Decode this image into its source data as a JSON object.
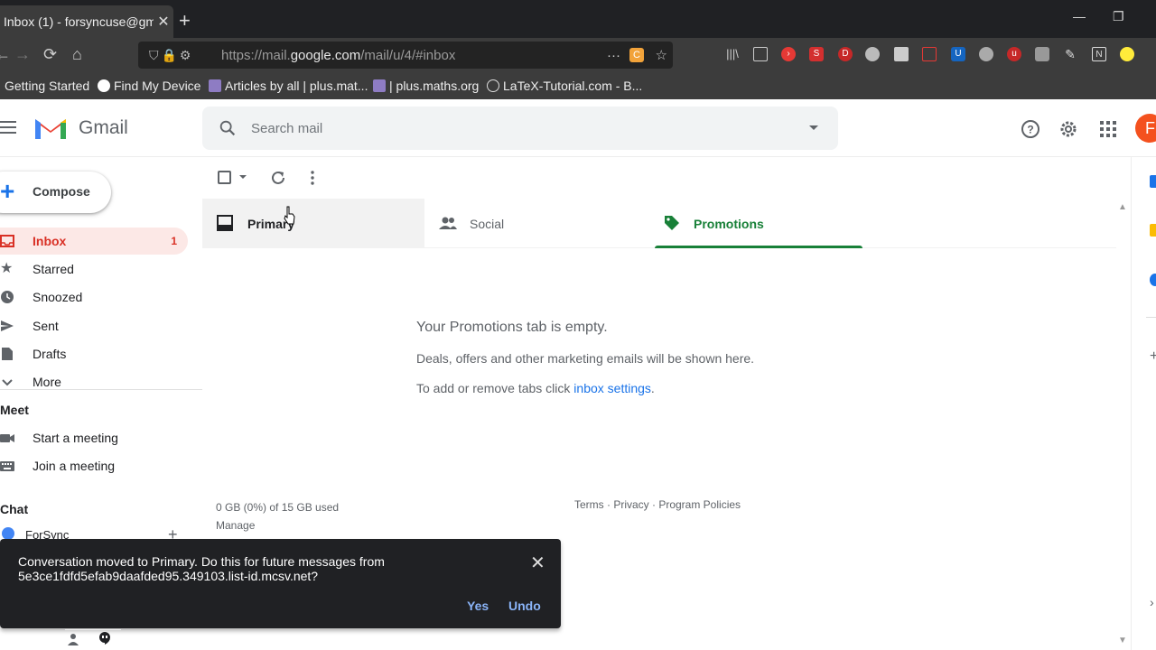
{
  "browser": {
    "tab_title": "Inbox (1) - forsyncuse@gm",
    "tab_close": "✕",
    "new_tab": "+",
    "url_prefix": "https://mail.",
    "url_domain": "google.com",
    "url_path": "/mail/u/4/#inbox",
    "url_dots": "···",
    "ext_c": "C",
    "bookmarks": [
      "Getting Started",
      "Find My Device",
      "Articles by all | plus.mat...",
      "| plus.maths.org",
      "LaTeX-Tutorial.com - B..."
    ]
  },
  "header": {
    "app_name": "Gmail",
    "search_placeholder": "Search mail",
    "avatar_letter": "F"
  },
  "sidebar": {
    "compose_label": "Compose",
    "items": [
      {
        "label": "Inbox",
        "count": "1"
      },
      {
        "label": "Starred"
      },
      {
        "label": "Snoozed"
      },
      {
        "label": "Sent"
      },
      {
        "label": "Drafts"
      },
      {
        "label": "More"
      }
    ],
    "meet_title": "Meet",
    "meet_items": [
      "Start a meeting",
      "Join a meeting"
    ],
    "chat_title": "Chat",
    "chat_user": "ForSync"
  },
  "tabs": [
    {
      "label": "Primary"
    },
    {
      "label": "Social"
    },
    {
      "label": "Promotions"
    }
  ],
  "empty": {
    "title": "Your Promotions tab is empty.",
    "desc": "Deals, offers and other marketing emails will be shown here.",
    "settings_prefix": "To add or remove tabs click ",
    "settings_link": "inbox settings",
    "settings_suffix": "."
  },
  "footer": {
    "storage": "0 GB (0%) of 15 GB used",
    "manage": "Manage",
    "links": "Terms · Privacy · Program Policies"
  },
  "toast": {
    "message": "Conversation moved to Primary. Do this for future messages from 5e3ce1fdfd5efab9daafded95.349103.list-id.mcsv.net?",
    "yes": "Yes",
    "undo": "Undo"
  },
  "colors": {
    "active_red": "#d93025",
    "promo_green": "#188038",
    "link_blue": "#1a73e8"
  }
}
